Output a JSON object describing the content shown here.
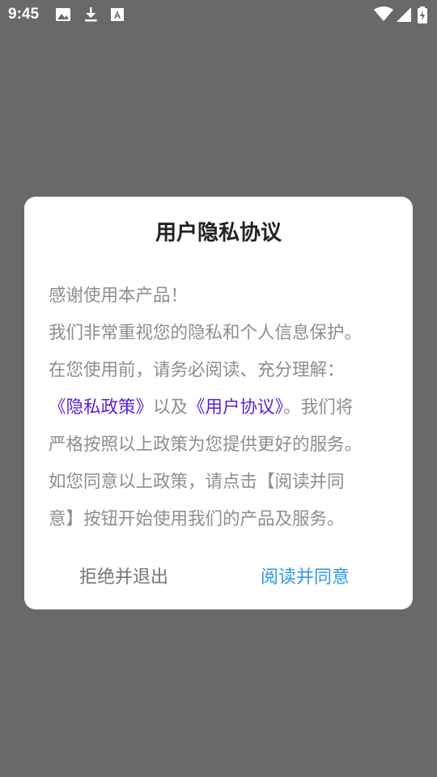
{
  "status_bar": {
    "time": "9:45",
    "left_icons": [
      "image-icon",
      "download-icon",
      "font-icon"
    ],
    "right_icons": [
      "wifi-icon",
      "signal-icon",
      "battery-icon"
    ]
  },
  "dialog": {
    "title": "用户隐私协议",
    "body": {
      "line1": "感谢使用本产品！",
      "line2": "我们非常重视您的隐私和个人信息保护。",
      "line3": "在您使用前，请务必阅读、充分理解：",
      "privacy_link": "《隐私政策》",
      "and_text": "以及",
      "user_agreement_link": "《用户协议》",
      "line4_tail": "。我们将",
      "line5": "严格按照以上政策为您提供更好的服务。",
      "line6": "如您同意以上政策，请点击【阅读并同",
      "line7": "意】按钮开始使用我们的产品及服务。"
    },
    "buttons": {
      "reject": "拒绝并退出",
      "agree": "阅读并同意"
    }
  },
  "colors": {
    "overlay": "#696969",
    "dialog_bg": "#ffffff",
    "link": "#5b1fd6",
    "agree_button": "#2f9be6",
    "reject_button": "#777777"
  }
}
